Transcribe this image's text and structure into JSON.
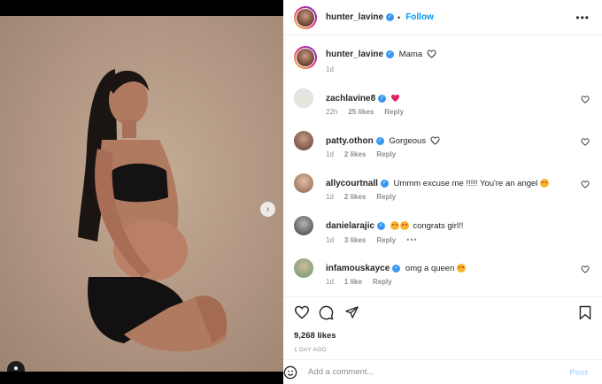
{
  "post": {
    "author": "hunter_lavine",
    "follow_label": "Follow",
    "separator": "•",
    "more_label": "•••",
    "caption_text": "Mama",
    "caption_time": "1d"
  },
  "media": {
    "next_label": "›",
    "slides": 3,
    "active_slide": 1
  },
  "comments": [
    {
      "user": "zachlavine8",
      "text": "",
      "emojis": [
        "red-heart"
      ],
      "time": "22h",
      "likes": "25 likes",
      "reply": "Reply",
      "avatar_color": "#e8e4e0"
    },
    {
      "user": "patty.othon",
      "text": "Gorgeous",
      "emojis": [
        "white-heart"
      ],
      "time": "1d",
      "likes": "2 likes",
      "reply": "Reply",
      "avatar_color": "#8a6a5a"
    },
    {
      "user": "allycourtnall",
      "text": "Ummm excuse me !!!!! You're an angel",
      "emojis": [
        "star-struck"
      ],
      "time": "1d",
      "likes": "2 likes",
      "reply": "Reply",
      "avatar_color": "#c4a084"
    },
    {
      "user": "danielarajic",
      "text": "congrats girl!!",
      "emojis": [
        "star-struck",
        "star-struck"
      ],
      "time": "1d",
      "likes": "3 likes",
      "reply": "Reply",
      "more": "•••",
      "avatar_color": "#6a6a6a"
    },
    {
      "user": "infamouskayce",
      "text": "omg a queen",
      "emojis": [
        "star-struck"
      ],
      "time": "1d",
      "likes": "1 like",
      "reply": "Reply",
      "avatar_color": "#9fc6a8"
    }
  ],
  "stats": {
    "likes": "9,268 likes",
    "ago": "1 DAY AGO"
  },
  "add_comment": {
    "placeholder": "Add a comment...",
    "post_label": "Post"
  },
  "colors": {
    "accent": "#0095f6",
    "verified": "#3897f0",
    "post_disabled": "#b3dbff",
    "backdrop": "#b59c86"
  }
}
